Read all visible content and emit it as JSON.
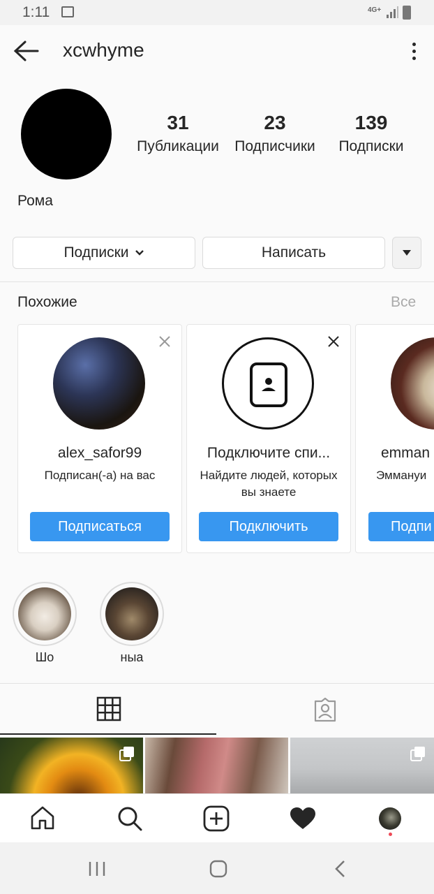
{
  "status_bar": {
    "time": "1:11",
    "network": "4G+"
  },
  "header": {
    "username": "xcwhyme"
  },
  "profile": {
    "full_name": "Рома",
    "stats": [
      {
        "value": "31",
        "label": "Публикации"
      },
      {
        "value": "23",
        "label": "Подписчики"
      },
      {
        "value": "139",
        "label": "Подписки"
      }
    ]
  },
  "actions": {
    "following_label": "Подписки",
    "message_label": "Написать"
  },
  "similar": {
    "title": "Похожие",
    "see_all": "Все",
    "cards": [
      {
        "name": "alex_safor99",
        "subtitle": "Подписан(-а) на вас",
        "button": "Подписаться"
      },
      {
        "name": "Подключите спи...",
        "subtitle": "Найдите людей, которых вы знаете",
        "button": "Подключить"
      },
      {
        "name": "emman",
        "subtitle": "Эммануи",
        "button": "Подпи"
      }
    ]
  },
  "highlights": [
    {
      "label": "Шо"
    },
    {
      "label": "ныа"
    }
  ],
  "colors": {
    "accent": "#3897f0",
    "text": "#262626",
    "muted": "#aaaaaa",
    "notification_dot": "#ed4956"
  }
}
